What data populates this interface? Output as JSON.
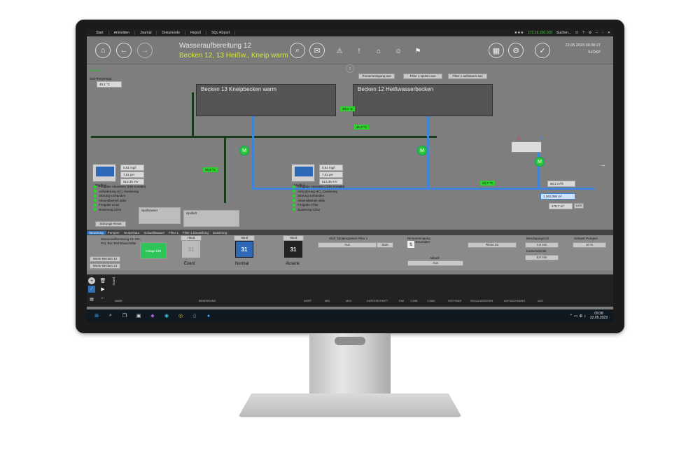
{
  "menu": [
    "Start",
    "Anmelden",
    "Journal",
    "Dokumente",
    "Report",
    "SQL Report"
  ],
  "menu_right": {
    "stars": "★★★",
    "ip": "172.16.100.100",
    "search": "Suchen..."
  },
  "header": {
    "title": "Wasseraufbereitung 12",
    "subtitle": "Becken 12, 13 Heißw., Kneip warm",
    "date": "22.05.2023 09:38:27",
    "user": "SJOKP"
  },
  "top": {
    "normal": "Normal",
    "soll_label": "Soll-Temperatur",
    "soll_value": "40,1 °C"
  },
  "controls": {
    "rinne": "Rinnenreinigung aus",
    "filter_spuelen": "Filter 1 spülen aus",
    "filter_aufstauen": "Filter 1 aufstauen aus"
  },
  "tanks": {
    "left": "Becken 13  Kneipbecken warm",
    "right": "Becken 12 Heißwasserbecken"
  },
  "temps": {
    "t1": "40,0 °C",
    "t2": "41,3 °C",
    "t3": "40,8 °C",
    "t4": "42,7 °C"
  },
  "modbus": [
    {
      "label": "Modbus",
      "v1": "0,61 mg/l",
      "v2": "7,01 pH",
      "v3": "813,35 mV"
    },
    {
      "label": "Modbus",
      "v1": "0,61 mg/l",
      "v2": "7,01 pH",
      "v3": "813,35 mV"
    }
  ],
  "status_items": [
    "Freigabe Absenken (DIN Kontakt)",
    "Anforderung HCL-Dosierung",
    "Störung vorhanden",
    "Absenkbetrieb aktiv",
    "Freigabe Chlor",
    "Dosierung Chlor"
  ],
  "stoerung_reset": "Störungs-Reset",
  "spuelwasser": "Spülwasser",
  "spuelluft": "Spülluft",
  "flow": {
    "flow1": "1.362,086 m³",
    "flow2": "60,2 m³/h",
    "flow3": "979,7 m³",
    "lern": "Lern"
  },
  "tabs": [
    "Steuerung",
    "Pumpen",
    "Temperatur",
    "Schwallwasser",
    "Filter 1",
    "Filter 1 Einstellung",
    "Dosierung"
  ],
  "lower": {
    "desc": "Wasseraufbereitung 12, UG, Rot, Bac Betriebsschalter",
    "werte12": "Werte Becken 12",
    "werte13": "Werte Becken 13",
    "anlage": "Anlage EIN",
    "hand": "Hand",
    "event": "Event",
    "normal": "Normal",
    "absenk": "Absenk",
    "cal_day": "31",
    "spuel_label": "Start Spülprogramm Filter 1",
    "spuel_value": "Aus",
    "start": "Start",
    "rinne_label": "Rinnenreinigung Betriebsschalter",
    "aktuell": "Aktuell",
    "aktuell_value": "Aus",
    "rinne_zu": "Rinne Zu",
    "beruhigung_label": "Beruhigungszeit",
    "beruhigung_value": "4,0 min",
    "konservierung_label": "Konservierzeit",
    "konservierung_value": "5,0 min",
    "sollwert_label": "Sollwert Pumpen",
    "sollwert_value": "10 %"
  },
  "trend": {
    "label": "Stand",
    "columns": [
      "NAME",
      "BEMERKUNG",
      "WERT",
      "MIN",
      "MAX",
      "DURCHSCHNITT",
      "DIM",
      "Y-MIN",
      "Y-MAX",
      "SICHTBAR",
      "SKALA ANZEIGEN",
      "AUFZEICHNUNG",
      "ZEIT"
    ]
  },
  "taskbar": {
    "time": "09:38",
    "date": "22.05.2023"
  }
}
